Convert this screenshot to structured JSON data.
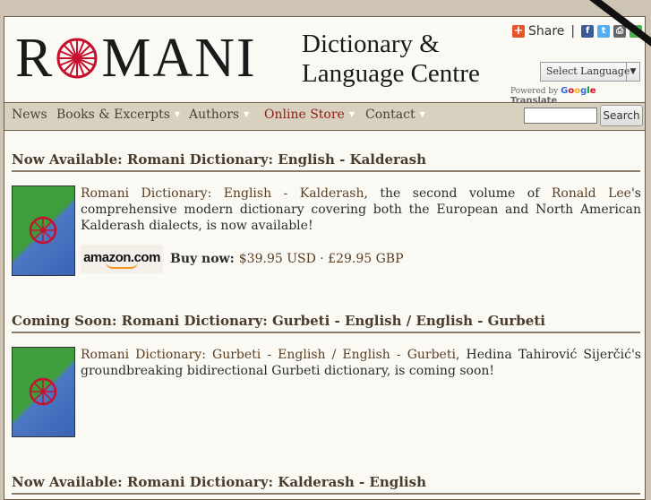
{
  "header": {
    "logo_first": "R",
    "logo_rest": "MANI",
    "subtitle_line1": "Dictionary &",
    "subtitle_line2": "Language Centre",
    "share_label": "Share",
    "share_sep": "|",
    "social_icons": [
      "facebook-icon",
      "twitter-icon",
      "print-icon",
      "google-bookmark-icon"
    ],
    "language_select": "Select Language",
    "powered_by": "Powered by",
    "translate": "Translate"
  },
  "nav": {
    "items": [
      {
        "label": "News"
      },
      {
        "label": "Books & Excerpts"
      },
      {
        "label": "Authors"
      },
      {
        "label": "Online Store"
      },
      {
        "label": "Contact"
      }
    ],
    "search_button": "Search",
    "search_value": ""
  },
  "posts": [
    {
      "title": "Now Available: Romani Dictionary: English - Kalderash",
      "link_title": "Romani Dictionary: English - Kalderash",
      "author": "Ronald Lee",
      "text_pre": ", the second volume of ",
      "text_post": "'s comprehensive modern dictionary covering both the European and North American Kalderash dialects, is now available!",
      "buy_label": "Buy now:",
      "price": "$39.95 USD · £29.95 GBP",
      "store": "amazon.com"
    },
    {
      "title": "Coming Soon: Romani Dictionary: Gurbeti - English / English - Gurbeti",
      "link_title": "Romani Dictionary: Gurbeti - English / English - Gurbeti",
      "text_post": ", Hedina Tahirović Sijerčić's groundbreaking bidirectional Gurbeti dictionary, is coming soon!"
    },
    {
      "title": "Now Available: Romani Dictionary: Kalderash - English"
    }
  ],
  "colors": {
    "accent_link": "#5a3e22",
    "store_nav": "#8f1d14",
    "nav_bg": "#d9d1c0",
    "page_bg": "#fbf9f4"
  }
}
